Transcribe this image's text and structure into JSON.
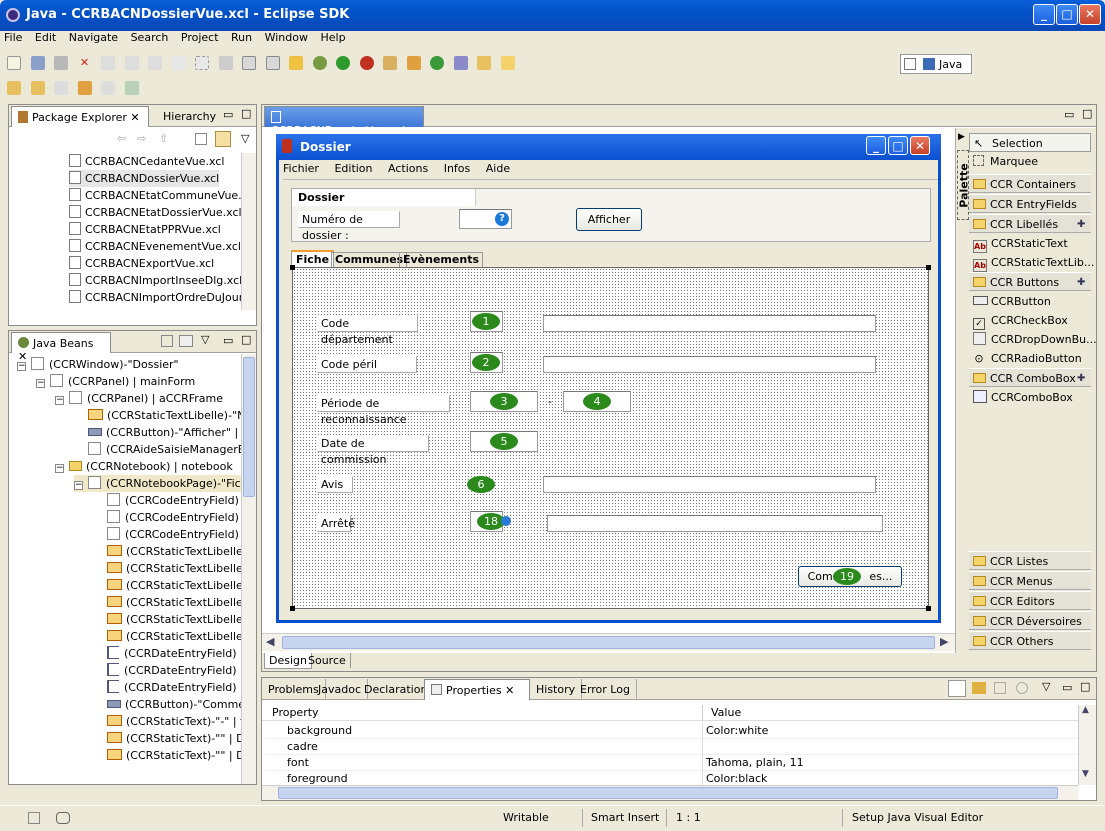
{
  "window": {
    "title": "Java - CCRBACNDossierVue.xcl - Eclipse SDK"
  },
  "menu": [
    "File",
    "Edit",
    "Navigate",
    "Search",
    "Project",
    "Run",
    "Window",
    "Help"
  ],
  "perspective": {
    "label": "Java"
  },
  "package_explorer": {
    "tabs": [
      "Package Explorer",
      "Hierarchy"
    ],
    "files": [
      "CCRBACNCedanteVue.xcl",
      "CCRBACNDossierVue.xcl",
      "CCRBACNEtatCommuneVue.xc",
      "CCRBACNEtatDossierVue.xcl",
      "CCRBACNEtatPPRVue.xcl",
      "CCRBACNEvenementVue.xcl",
      "CCRBACNExportVue.xcl",
      "CCRBACNImportInseeDlg.xcl",
      "CCRBACNImportOrdreDuJourC"
    ]
  },
  "java_beans": {
    "tab": "Java Beans",
    "items": [
      {
        "text": "(CCRWindow)-\"Dossier\"",
        "indent": 0,
        "icon": "box",
        "exp": "−"
      },
      {
        "text": "(CCRPanel) | mainForm",
        "indent": 1,
        "icon": "box",
        "exp": "−"
      },
      {
        "text": "(CCRPanel) | aCCRFrame",
        "indent": 2,
        "icon": "box",
        "exp": "−"
      },
      {
        "text": "(CCRStaticTextLibelle)-\"Nu",
        "indent": 3,
        "icon": "label",
        "exp": ""
      },
      {
        "text": "(CCRButton)-\"Afficher\" | a",
        "indent": 3,
        "icon": "btn",
        "exp": ""
      },
      {
        "text": "(CCRAideSaisieManagerEr",
        "indent": 3,
        "icon": "box",
        "exp": ""
      },
      {
        "text": "(CCRNotebook) | notebook",
        "indent": 2,
        "icon": "folder",
        "exp": "−"
      },
      {
        "text": "(CCRNotebookPage)-\"Fich",
        "indent": 3,
        "icon": "box",
        "exp": "−"
      },
      {
        "text": "(CCRCodeEntryField)",
        "indent": 4,
        "icon": "box",
        "exp": ""
      },
      {
        "text": "(CCRCodeEntryField)",
        "indent": 4,
        "icon": "box",
        "exp": ""
      },
      {
        "text": "(CCRCodeEntryField)",
        "indent": 4,
        "icon": "box",
        "exp": ""
      },
      {
        "text": "(CCRStaticTextLibelle)",
        "indent": 4,
        "icon": "label",
        "exp": ""
      },
      {
        "text": "(CCRStaticTextLibelle)",
        "indent": 4,
        "icon": "label",
        "exp": ""
      },
      {
        "text": "(CCRStaticTextLibelle)",
        "indent": 4,
        "icon": "label",
        "exp": ""
      },
      {
        "text": "(CCRStaticTextLibelle)",
        "indent": 4,
        "icon": "label",
        "exp": ""
      },
      {
        "text": "(CCRStaticTextLibelle)",
        "indent": 4,
        "icon": "label",
        "exp": ""
      },
      {
        "text": "(CCRStaticTextLibelle)",
        "indent": 4,
        "icon": "label",
        "exp": ""
      },
      {
        "text": "(CCRDateEntryField) |",
        "indent": 4,
        "icon": "date",
        "exp": ""
      },
      {
        "text": "(CCRDateEntryField) |",
        "indent": 4,
        "icon": "date",
        "exp": ""
      },
      {
        "text": "(CCRDateEntryField) |",
        "indent": 4,
        "icon": "date",
        "exp": ""
      },
      {
        "text": "(CCRButton)-\"Commer",
        "indent": 4,
        "icon": "btn",
        "exp": ""
      },
      {
        "text": "(CCRStaticText)-\"-\" | t",
        "indent": 4,
        "icon": "label",
        "exp": ""
      },
      {
        "text": "(CCRStaticText)-\"\" | D",
        "indent": 4,
        "icon": "label",
        "exp": ""
      },
      {
        "text": "(CCRStaticText)-\"\" | D",
        "indent": 4,
        "icon": "label",
        "exp": ""
      }
    ]
  },
  "editor": {
    "tab": "CCRBACNDossierVue.xcl",
    "bottom_tabs": [
      "Design",
      "Source"
    ],
    "form": {
      "title": "Dossier",
      "menu": [
        "Fichier",
        "Edition",
        "Actions",
        "Infos",
        "Aide"
      ],
      "frame_title": "Dossier",
      "numero_label": "Numéro de dossier :",
      "afficher_button": "Afficher",
      "tabs": [
        "Fiche",
        "Communes",
        "Evènements"
      ],
      "rows": [
        {
          "label": "Code département",
          "num": "1"
        },
        {
          "label": "Code péril",
          "num": "2"
        },
        {
          "label": "Période de reconnaissance",
          "num": "3",
          "num2": "4",
          "sep": "-"
        },
        {
          "label": "Date de commission",
          "num": "5"
        },
        {
          "label": "Avis",
          "num": "6"
        },
        {
          "label": "Arrêté",
          "num": "18"
        }
      ],
      "communes_button": "Comm",
      "communes_button_tail": "es...",
      "communes_num": "19"
    }
  },
  "palette": {
    "title": "Palette",
    "items": [
      {
        "text": "Selection",
        "type": "tool"
      },
      {
        "text": "Marquee",
        "type": "tool"
      },
      {
        "text": "CCR Containers",
        "type": "drawer"
      },
      {
        "text": "CCR EntryFields",
        "type": "drawer"
      },
      {
        "text": "CCR Libellés",
        "type": "drawer",
        "pin": true
      },
      {
        "text": "CCRStaticText",
        "type": "item"
      },
      {
        "text": "CCRStaticTextLib...",
        "type": "item"
      },
      {
        "text": "CCR Buttons",
        "type": "drawer",
        "pin": true
      },
      {
        "text": "CCRButton",
        "type": "item"
      },
      {
        "text": "CCRCheckBox",
        "type": "item"
      },
      {
        "text": "CCRDropDownBu...",
        "type": "item"
      },
      {
        "text": "CCRRadioButton",
        "type": "item"
      },
      {
        "text": "CCR ComboBox",
        "type": "drawer",
        "pin": true
      },
      {
        "text": "CCRComboBox",
        "type": "item"
      }
    ],
    "bottom": [
      "CCR Listes",
      "CCR Menus",
      "CCR Editors",
      "CCR Déversoires",
      "CCR Others"
    ]
  },
  "bottom_panel": {
    "tabs": [
      "Problems",
      "Javadoc",
      "Declaration",
      "Properties",
      "History",
      "Error Log"
    ],
    "columns": [
      "Property",
      "Value"
    ],
    "rows": [
      {
        "property": "background",
        "value": "Color:white"
      },
      {
        "property": "cadre",
        "value": ""
      },
      {
        "property": "font",
        "value": "Tahoma, plain, 11"
      },
      {
        "property": "foreground",
        "value": "Color:black"
      }
    ]
  },
  "status": {
    "writable": "Writable",
    "insert": "Smart Insert",
    "position": "1 : 1",
    "message": "Setup Java Visual Editor"
  }
}
